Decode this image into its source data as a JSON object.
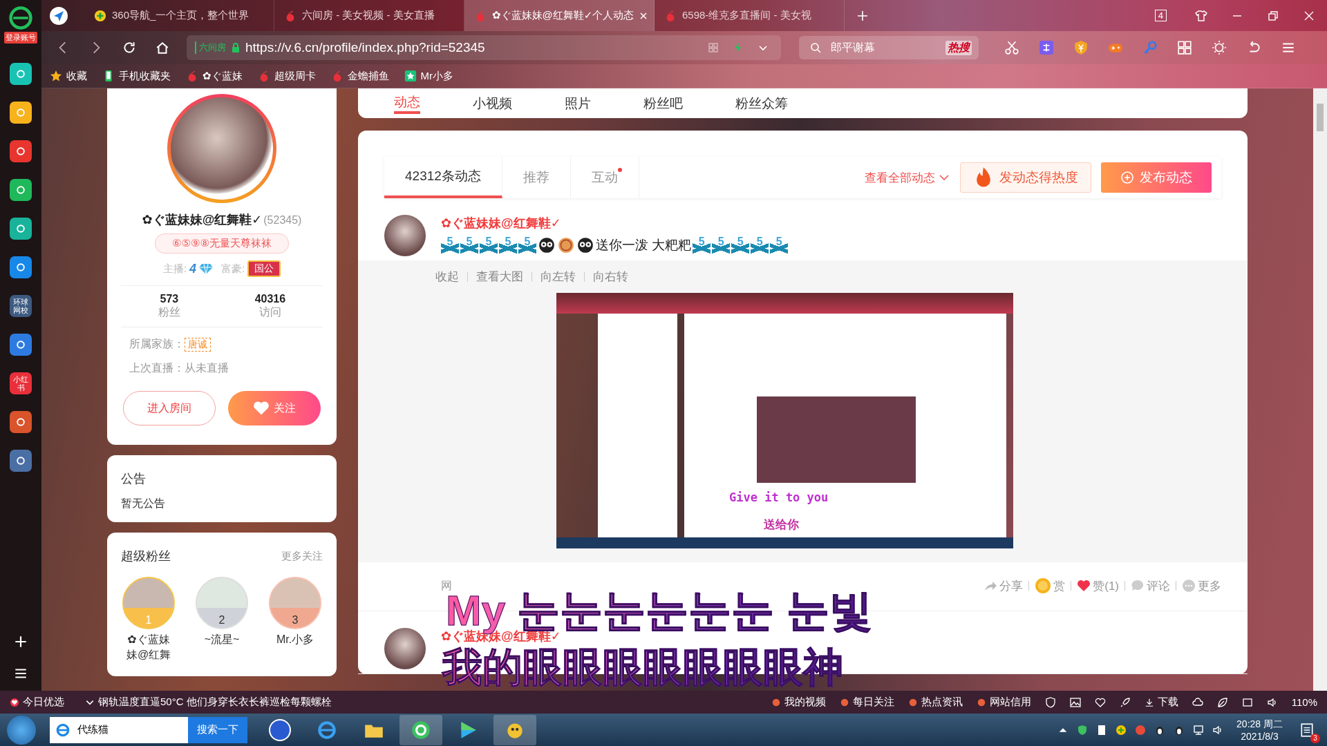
{
  "sidebar": {
    "login_label": "登录账号",
    "apps": [
      {
        "kind": "plain",
        "color": "#19c3b4"
      },
      {
        "kind": "plain",
        "color": "#f7b21c"
      },
      {
        "kind": "plain",
        "color": "#e8352e"
      },
      {
        "kind": "plain",
        "color": "#1fb85a"
      },
      {
        "kind": "plain",
        "color": "#18b39a"
      },
      {
        "kind": "plain",
        "color": "#1787e8"
      },
      {
        "kind": "text",
        "color": "#3d5a80",
        "text": "环球网校"
      },
      {
        "kind": "plain",
        "color": "#2d7be0"
      },
      {
        "kind": "text",
        "color": "#e8303a",
        "text": "小红书"
      },
      {
        "kind": "plain",
        "color": "#d9532b"
      },
      {
        "kind": "plain",
        "color": "#4a6fa5"
      }
    ]
  },
  "tabs": [
    {
      "title": "360导航_一个主页，整个世界",
      "selected": false
    },
    {
      "title": "六间房 - 美女视频 - 美女直播",
      "selected": false
    },
    {
      "title": "✿ぐ蓝妹妹@红舞鞋✓个人动态",
      "selected": true
    },
    {
      "title": "6598-维克多直播间 - 美女视",
      "selected": false
    }
  ],
  "tab_count": "4",
  "address": {
    "cert": "六间房",
    "url": "https://v.6.cn/profile/index.php?rid=52345"
  },
  "search": {
    "value": "郎平谢幕",
    "hot": "热搜"
  },
  "bookmarks": [
    "收藏",
    "手机收藏夹",
    "✿ぐ蓝妹",
    "超级周卡",
    "金蟾捕鱼",
    "Mr小多"
  ],
  "page_nav": [
    {
      "label": "动态",
      "selected": true
    },
    {
      "label": "小视频",
      "selected": false
    },
    {
      "label": "照片",
      "selected": false
    },
    {
      "label": "粉丝吧",
      "selected": false
    },
    {
      "label": "粉丝众筹",
      "selected": false
    }
  ],
  "profile": {
    "name": "✿ぐ蓝妹妹@红舞鞋✓",
    "rid": "(52345)",
    "signature": "⑥⑤⑨⑧无量天尊袜袜",
    "anchor_label": "主播:",
    "anchor_level": "4",
    "rich_label": "富豪:",
    "rich_badge": "国公",
    "stats": [
      {
        "value": "573",
        "label": "粉丝"
      },
      {
        "value": "40316",
        "label": "访问"
      }
    ],
    "family_label": "所属家族：",
    "family": "唐诚",
    "last_live": "上次直播：从未直播",
    "enter_button": "进入房间",
    "follow_button": "关注"
  },
  "notice": {
    "title": "公告",
    "text": "暂无公告"
  },
  "super_fans": {
    "title": "超级粉丝",
    "more": "更多关注",
    "fans": [
      {
        "rank": "1",
        "name": "✿ぐ蓝妹妹@红舞"
      },
      {
        "rank": "2",
        "name": "~流星~"
      },
      {
        "rank": "3",
        "name": "Mr.小多"
      }
    ]
  },
  "feed_tabs": [
    {
      "label": "42312条动态",
      "selected": true,
      "new_dot": false
    },
    {
      "label": "推荐",
      "selected": false,
      "new_dot": false
    },
    {
      "label": "互动",
      "selected": false,
      "new_dot": true
    }
  ],
  "view_all": "查看全部动态",
  "hot_button": "发动态得热度",
  "publish_button": "发布动态",
  "posts": [
    {
      "author": "✿ぐ蓝妹妹@红舞鞋✓",
      "content": [
        {
          "kind": "badge",
          "text": "5"
        },
        {
          "kind": "badge",
          "text": "5"
        },
        {
          "kind": "badge",
          "text": "5"
        },
        {
          "kind": "badge",
          "text": "5"
        },
        {
          "kind": "badge",
          "text": "5"
        },
        {
          "kind": "face"
        },
        {
          "kind": "coin"
        },
        {
          "kind": "face"
        },
        {
          "kind": "text",
          "text": "送你一泼 大粑粑"
        },
        {
          "kind": "badge",
          "text": "5"
        },
        {
          "kind": "badge",
          "text": "5"
        },
        {
          "kind": "badge",
          "text": "5"
        },
        {
          "kind": "badge",
          "text": "5"
        },
        {
          "kind": "badge",
          "text": "5"
        }
      ],
      "tools": [
        "收起",
        "查看大图",
        "向左转",
        "向右转"
      ],
      "image_captions": [
        "Give it to you",
        "送给你"
      ],
      "meta": "网",
      "actions": [
        {
          "kind": "share",
          "label": "分享"
        },
        {
          "kind": "reward",
          "label": "赏"
        },
        {
          "kind": "like",
          "label": "赞(1)"
        },
        {
          "kind": "comment",
          "label": "评论"
        },
        {
          "kind": "more",
          "label": "更多"
        }
      ]
    },
    {
      "author": "✿ぐ蓝妹妹@红舞鞋✓"
    }
  ],
  "overlay_captions": [
    "My 눈눈눈눈눈눈 눈빛",
    "我的眼眼眼眼眼眼眼神"
  ],
  "status_bar": {
    "today": "今日优选",
    "news": "钢轨温度直逼50°C 他们身穿长衣长裤巡检每颗螺栓",
    "links": [
      "我的视频",
      "每日关注",
      "热点资讯",
      "网站信用"
    ],
    "download": "下载",
    "zoom": "110%"
  },
  "taskbar": {
    "search_value": "代练猫",
    "search_button": "搜索一下",
    "time": "20:28 周二",
    "date": "2021/8/3",
    "notifications": "3"
  }
}
